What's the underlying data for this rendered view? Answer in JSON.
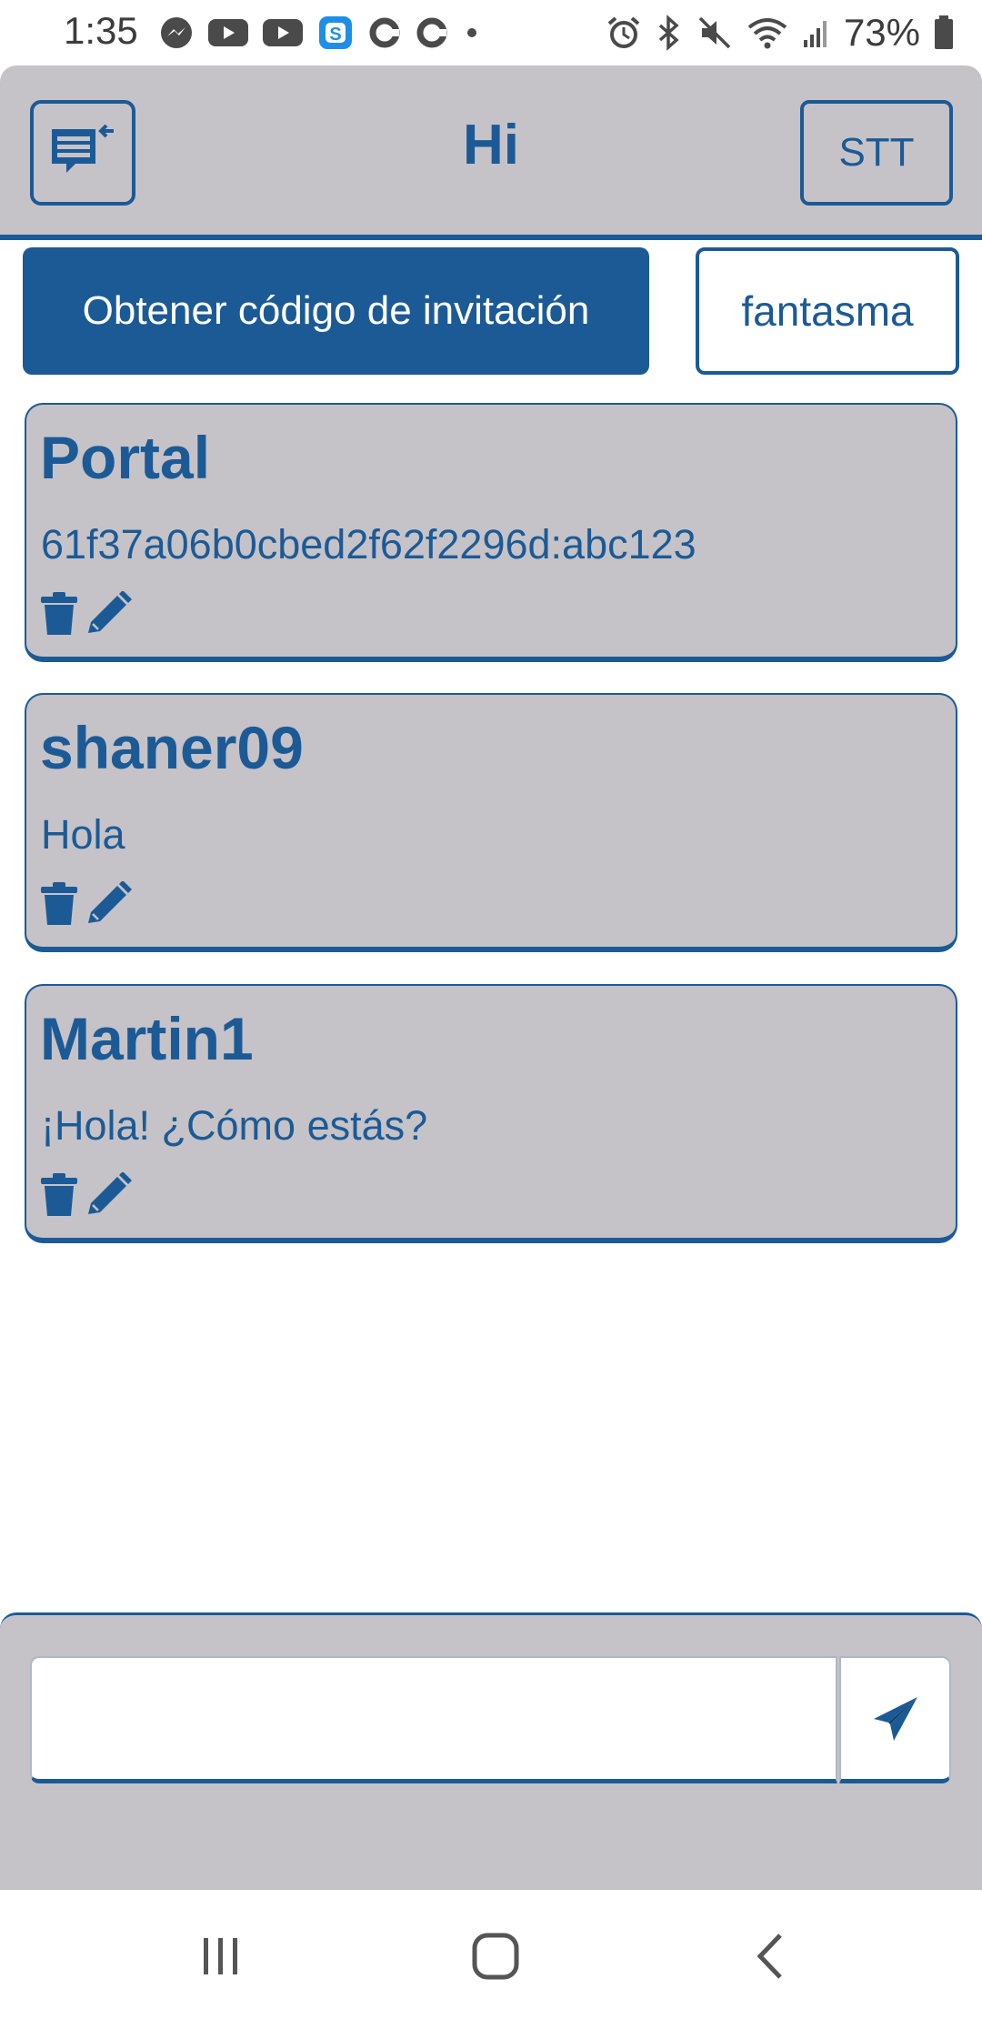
{
  "status_bar": {
    "time": "1:35",
    "battery": "73%",
    "left_icons": [
      "messenger-icon",
      "youtube-icon",
      "youtube-icon",
      "s-app-icon",
      "c-app-icon",
      "c-app-icon",
      "dot-icon"
    ],
    "right_icons": [
      "alarm-icon",
      "bluetooth-icon",
      "mute-icon",
      "wifi-icon",
      "signal-icon",
      "battery-icon"
    ]
  },
  "header": {
    "title": "Hi",
    "menu_icon": "chat-list-back-icon",
    "stt_label": "STT"
  },
  "actions": {
    "invite_label": "Obtener código de invitación",
    "ghost_label": "fantasma"
  },
  "messages": [
    {
      "author": "Portal",
      "text": "61f37a06b0cbed2f62f2296d:abc123"
    },
    {
      "author": "shaner09",
      "text": "Hola"
    },
    {
      "author": "Martin1",
      "text": "¡Hola! ¿Cómo estás?"
    }
  ],
  "composer": {
    "input_value": "",
    "input_placeholder": "",
    "send_icon": "paper-plane-icon"
  },
  "nav_bar": {
    "items": [
      "recent-apps-icon",
      "home-icon",
      "back-icon"
    ]
  },
  "colors": {
    "accent": "#1c5a96",
    "panel": "#c5c3c7",
    "background": "#ffffff"
  }
}
